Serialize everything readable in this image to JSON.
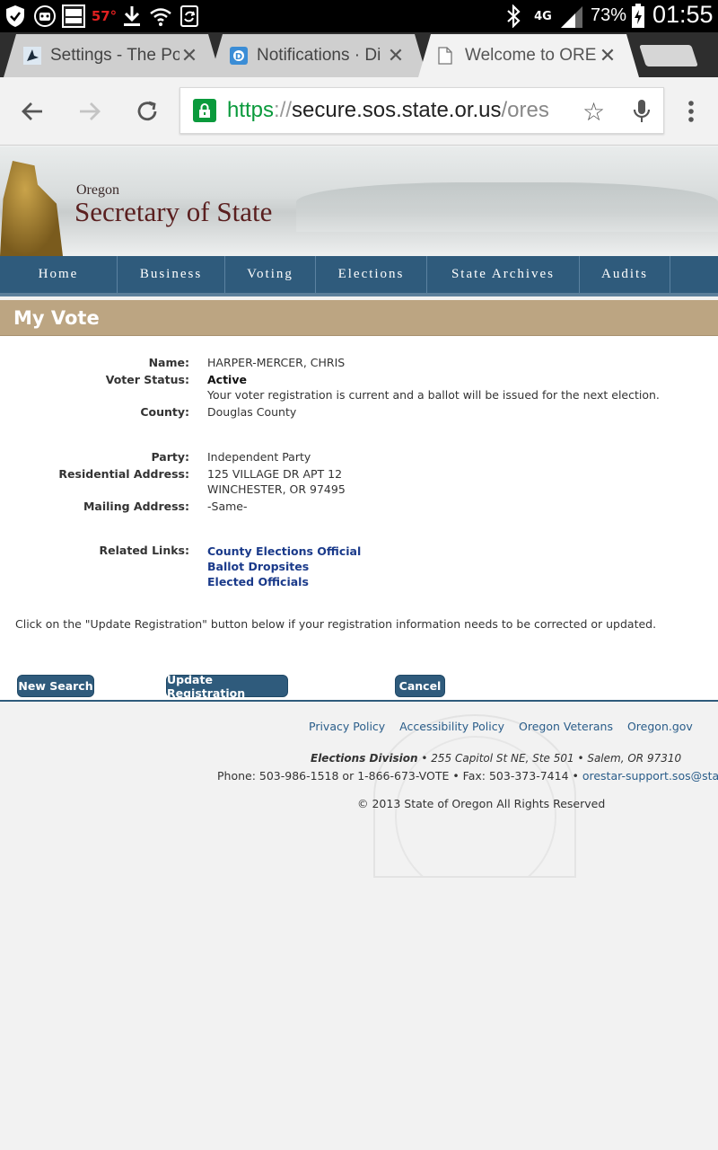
{
  "status_bar": {
    "temperature": "57°",
    "battery": "73%",
    "time": "01:55",
    "network": "4G"
  },
  "tabs": [
    {
      "title": "Settings - The Po",
      "icon": "bird-favicon"
    },
    {
      "title": "Notifications · Di",
      "icon": "discourse-favicon"
    },
    {
      "title": "Welcome to ORE",
      "icon": "page-favicon",
      "active": true
    }
  ],
  "omnibox": {
    "scheme": "https",
    "sep": "://",
    "host": "secure.sos.state.or.us",
    "path": "/ores"
  },
  "banner": {
    "oregon": "Oregon",
    "title": "Secretary of State"
  },
  "nav": [
    "Home",
    "Business",
    "Voting",
    "Elections",
    "State Archives",
    "Audits"
  ],
  "heading": "My Vote",
  "voter": {
    "name_label": "Name:",
    "name": "HARPER-MERCER, CHRIS",
    "status_label": "Voter Status:",
    "status": "Active",
    "status_note": "Your voter registration is current and a ballot will be issued for the next election.",
    "county_label": "County:",
    "county": "Douglas County",
    "party_label": "Party:",
    "party": "Independent Party",
    "res_label": "Residential Address:",
    "res_line1": "125 VILLAGE DR APT 12",
    "res_line2": "WINCHESTER, OR 97495",
    "mail_label": "Mailing Address:",
    "mail": "-Same-",
    "links_label": "Related Links:",
    "links": [
      "County Elections Official",
      "Ballot Dropsites",
      "Elected Officials"
    ]
  },
  "note": "Click on the \"Update Registration\" button below if your registration information needs to be corrected or updated.",
  "buttons": {
    "new_search": "New Search",
    "update": "Update Registration",
    "cancel": "Cancel"
  },
  "footer": {
    "links": [
      "Privacy Policy",
      "Accessibility Policy",
      "Oregon Veterans",
      "Oregon.gov"
    ],
    "division": "Elections Division",
    "address": " • 255 Capitol St NE, Ste 501 • Salem, OR 97310",
    "phone": "Phone: 503-986-1518 or 1-866-673-VOTE • Fax: 503-373-7414 • ",
    "email": "orestar-support.sos@state.or.us",
    "copyright": "© 2013 State of Oregon All Rights Reserved"
  },
  "colors": {
    "nav_bg": "#2f5b7c",
    "heading_bg": "#bca582",
    "secure_green": "#0a9a3c",
    "link": "#1a3a8a"
  }
}
